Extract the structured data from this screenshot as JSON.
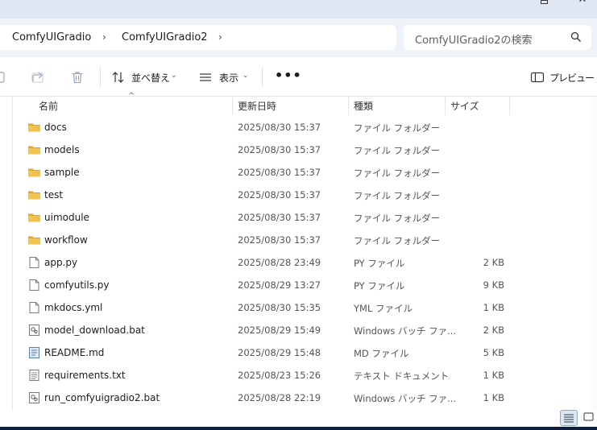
{
  "window": {
    "maximize_glyph": "□",
    "close_glyph": "✕"
  },
  "breadcrumb": {
    "items": [
      "ComfyUIGradio",
      "ComfyUIGradio2"
    ],
    "separator": "›"
  },
  "search": {
    "placeholder": "ComfyUIGradio2の検索"
  },
  "commandbar": {
    "sort_label": "並べ替え",
    "view_label": "表示",
    "more_label": "•••",
    "preview_label": "プレビュー",
    "chevron": "⌄"
  },
  "columns": {
    "name": "名前",
    "date": "更新日時",
    "type": "種類",
    "size": "サイズ",
    "sort_indicator": "^"
  },
  "files": [
    {
      "name": "docs",
      "date": "2025/08/30 15:37",
      "type": "ファイル フォルダー",
      "size": "",
      "icon": "folder-icon"
    },
    {
      "name": "models",
      "date": "2025/08/30 15:37",
      "type": "ファイル フォルダー",
      "size": "",
      "icon": "folder-icon"
    },
    {
      "name": "sample",
      "date": "2025/08/30 15:37",
      "type": "ファイル フォルダー",
      "size": "",
      "icon": "folder-icon"
    },
    {
      "name": "test",
      "date": "2025/08/30 15:37",
      "type": "ファイル フォルダー",
      "size": "",
      "icon": "folder-icon"
    },
    {
      "name": "uimodule",
      "date": "2025/08/30 15:37",
      "type": "ファイル フォルダー",
      "size": "",
      "icon": "folder-icon"
    },
    {
      "name": "workflow",
      "date": "2025/08/30 15:37",
      "type": "ファイル フォルダー",
      "size": "",
      "icon": "folder-icon"
    },
    {
      "name": "app.py",
      "date": "2025/08/28 23:49",
      "type": "PY ファイル",
      "size": "2 KB",
      "icon": "file-icon"
    },
    {
      "name": "comfyutils.py",
      "date": "2025/08/29 13:27",
      "type": "PY ファイル",
      "size": "9 KB",
      "icon": "file-icon"
    },
    {
      "name": "mkdocs.yml",
      "date": "2025/08/30 15:35",
      "type": "YML ファイル",
      "size": "1 KB",
      "icon": "file-icon"
    },
    {
      "name": "model_download.bat",
      "date": "2025/08/29 15:49",
      "type": "Windows バッチ ファ...",
      "size": "2 KB",
      "icon": "batch-file-icon"
    },
    {
      "name": "README.md",
      "date": "2025/08/29 15:48",
      "type": "MD ファイル",
      "size": "5 KB",
      "icon": "markdown-file-icon"
    },
    {
      "name": "requirements.txt",
      "date": "2025/08/23 15:26",
      "type": "テキスト ドキュメント",
      "size": "1 KB",
      "icon": "text-file-icon"
    },
    {
      "name": "run_comfyuigradio2.bat",
      "date": "2025/08/28 22:19",
      "type": "Windows バッチ ファ...",
      "size": "1 KB",
      "icon": "batch-file-icon"
    }
  ],
  "colors": {
    "folder": "#f2c14e",
    "folder_dark": "#e3a82b",
    "accent": "#0067c0"
  }
}
